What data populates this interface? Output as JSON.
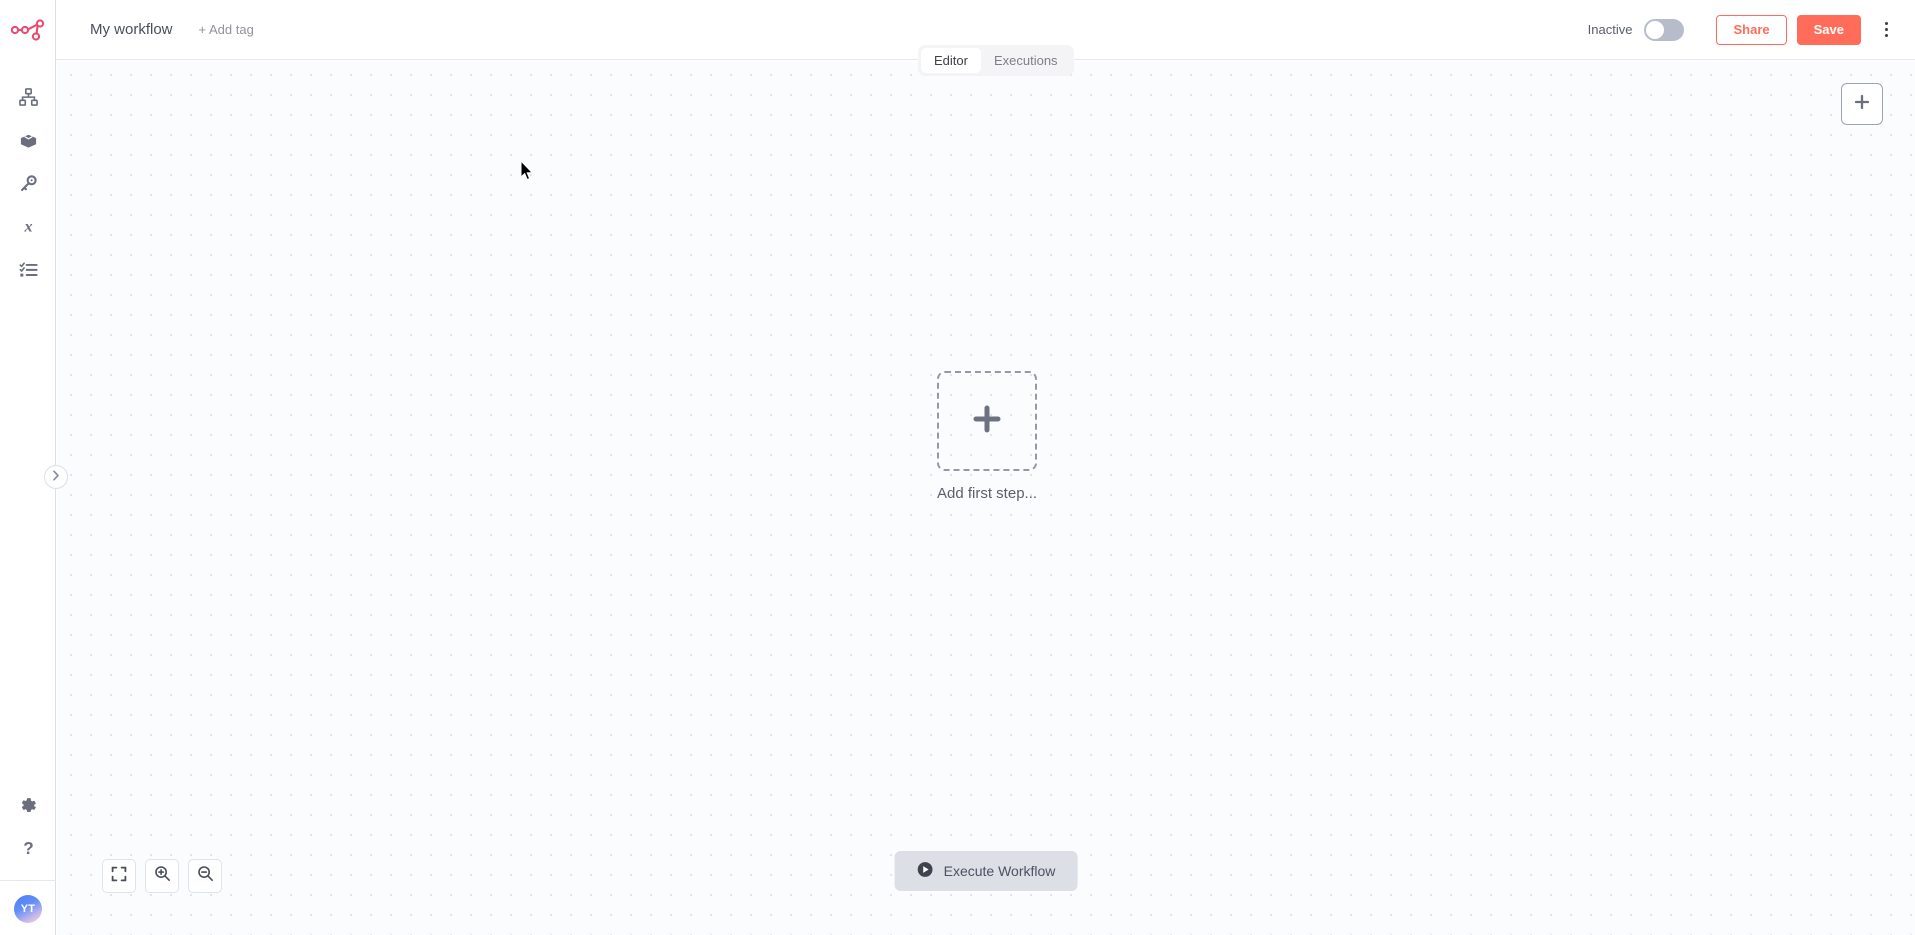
{
  "app": {
    "logo": "n8n-logo"
  },
  "sidebar": {
    "items": [
      {
        "name": "workflows",
        "icon": "sitemap-icon",
        "label": "Workflows"
      },
      {
        "name": "templates",
        "icon": "package-icon",
        "label": "Templates"
      },
      {
        "name": "credentials",
        "icon": "key-icon",
        "label": "Credentials"
      },
      {
        "name": "variables",
        "icon": "variable-x-icon",
        "label": "Variables"
      },
      {
        "name": "executions",
        "icon": "checklist-icon",
        "label": "Executions"
      }
    ],
    "bottom": [
      {
        "name": "settings",
        "icon": "gear-icon",
        "label": "Settings"
      },
      {
        "name": "help",
        "icon": "question-icon",
        "label": "Help"
      }
    ],
    "avatar_initials": "YT",
    "toggle_icon": "chevron-right-icon"
  },
  "header": {
    "workflow_name": "My workflow",
    "add_tag_label": "+ Add tag",
    "activation_label": "Inactive",
    "activation_state": "off",
    "share_label": "Share",
    "save_label": "Save",
    "more_icon": "kebab-menu-icon"
  },
  "tabs": [
    {
      "label": "Editor",
      "active": true
    },
    {
      "label": "Executions",
      "active": false
    }
  ],
  "canvas": {
    "add_node_icon": "plus-icon",
    "first_step": {
      "icon": "plus-icon",
      "label": "Add first step..."
    },
    "zoom_controls": [
      {
        "name": "zoom-to-fit",
        "icon": "fit-screen-icon"
      },
      {
        "name": "zoom-in",
        "icon": "magnifier-plus-icon"
      },
      {
        "name": "zoom-out",
        "icon": "magnifier-minus-icon"
      }
    ],
    "execute": {
      "label": "Execute Workflow",
      "icon": "play-circle-icon"
    }
  },
  "colors": {
    "brand": "#ff6d5a",
    "logo": "#ea4b71",
    "canvas_bg": "#fbfcfe",
    "dot_grid": "#e2e4ea",
    "text": "#525662"
  }
}
